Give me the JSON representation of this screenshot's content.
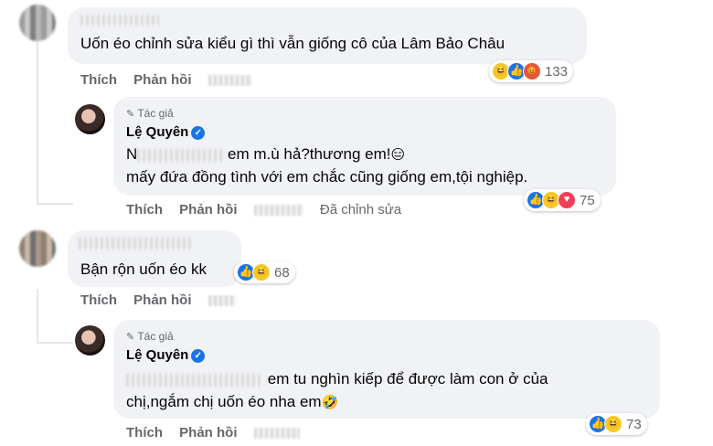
{
  "comments": [
    {
      "id": "c1",
      "name_blurred": true,
      "text": "Uốn éo chỉnh sửa kiểu gì thì vẫn giống cô của Lâm Bảo Châu",
      "reaction_count": "133",
      "reactions": [
        "haha-icon",
        "like-icon",
        "angry-icon"
      ]
    },
    {
      "id": "r1",
      "author_label": "Tác giả",
      "name": "Lệ Quyên",
      "line1_prefix": "N",
      "line1": "em m.ù hả?thương em!",
      "line1_emoji": "😑",
      "line2": "mấy đứa đồng tình với em chắc cũng giống em,tội nghiệp.",
      "reaction_count": "75",
      "reactions": [
        "like-icon",
        "haha-icon",
        "love-icon"
      ],
      "edited": "Đã chỉnh sửa"
    },
    {
      "id": "c2",
      "name_blurred": true,
      "text": "Bận rộn uốn éo kk",
      "reaction_count": "68",
      "reactions": [
        "like-icon",
        "haha-icon"
      ]
    },
    {
      "id": "r2",
      "author_label": "Tác giả",
      "name": "Lệ Quyên",
      "line1": "em tu nghìn kiếp để được làm con ở của",
      "line2": "chị,ngắm chị uốn éo nha em",
      "line2_emoji": "🤣",
      "reaction_count": "73",
      "reactions": [
        "like-icon",
        "haha-icon"
      ]
    }
  ],
  "actions": {
    "like": "Thích",
    "reply": "Phản hồi"
  },
  "colors": {
    "bubble": "#f0f2f5",
    "meta": "#65676b",
    "like": "#1b74e4",
    "haha": "#f7c928",
    "angry": "#e4573d",
    "love": "#f33e58"
  }
}
